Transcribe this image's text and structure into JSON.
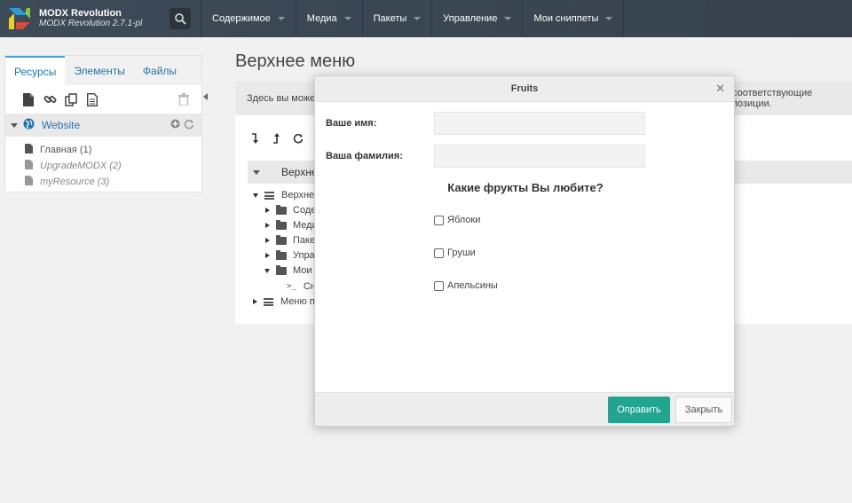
{
  "topbar": {
    "brand_title": "MODX Revolution",
    "brand_version": "MODX Revolution 2.7.1-pl",
    "nav": [
      {
        "label": "Содержимое"
      },
      {
        "label": "Медиа"
      },
      {
        "label": "Пакеты"
      },
      {
        "label": "Управление"
      },
      {
        "label": "Мои сниппеты"
      }
    ]
  },
  "sidebar": {
    "tabs": [
      {
        "label": "Ресурсы",
        "active": true
      },
      {
        "label": "Элементы",
        "active": false
      },
      {
        "label": "Файлы",
        "active": false
      }
    ],
    "tools": [
      "new-document-icon",
      "weblink-icon",
      "symlink-icon",
      "static-resource-icon",
      "trash-icon"
    ],
    "context": "Website",
    "resources": [
      {
        "label": "Главная (1)",
        "published": true
      },
      {
        "label": "UpgradeMODX (2)",
        "published": false
      },
      {
        "label": "myResource (3)",
        "published": false
      }
    ]
  },
  "main": {
    "title": "Верхнее меню",
    "hint_left": "Здесь вы может",
    "hint_right": "соответствующие позиции.",
    "tree_header": "Верхне",
    "tree": [
      {
        "label": "Верхнее",
        "type": "menu",
        "state": "open"
      },
      {
        "label": "Соде",
        "type": "folder",
        "state": "closed"
      },
      {
        "label": "Меди",
        "type": "folder",
        "state": "closed"
      },
      {
        "label": "Пакет",
        "type": "folder",
        "state": "closed"
      },
      {
        "label": "Управ",
        "type": "folder",
        "state": "closed"
      },
      {
        "label": "Мои с",
        "type": "folder",
        "state": "open"
      },
      {
        "label": "Сн",
        "type": "snippet",
        "state": "leaf"
      },
      {
        "label": "Меню п",
        "type": "menu",
        "state": "closed"
      }
    ]
  },
  "modal": {
    "title": "Fruits",
    "fields": [
      {
        "label": "Ваше имя:",
        "value": "",
        "placeholder": ""
      },
      {
        "label": "Ваша фамилия:",
        "value": "",
        "placeholder": ""
      }
    ],
    "question": "Какие фрукты Вы любите?",
    "options": [
      {
        "label": "Яблоки",
        "checked": false
      },
      {
        "label": "Груши",
        "checked": false
      },
      {
        "label": "Апельсины",
        "checked": false
      }
    ],
    "submit_label": "Оправить",
    "close_label": "Закрыть"
  },
  "colors": {
    "topbar": "#3d4a57",
    "accent_link": "#1f76b5",
    "submit_button": "#21a591"
  }
}
